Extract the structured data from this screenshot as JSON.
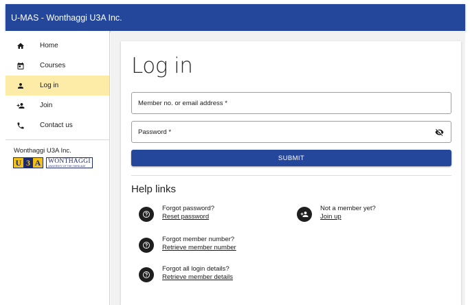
{
  "appbar": {
    "title": "U-MAS - Wonthaggi U3A Inc."
  },
  "sidebar": {
    "items": [
      {
        "label": "Home",
        "icon": "home-icon"
      },
      {
        "label": "Courses",
        "icon": "calendar-icon"
      },
      {
        "label": "Log in",
        "icon": "person-icon",
        "active": true
      },
      {
        "label": "Join",
        "icon": "person-add-icon"
      },
      {
        "label": "Contact us",
        "icon": "phone-icon"
      }
    ],
    "org_name": "Wonthaggi U3A Inc.",
    "logo": {
      "letters": [
        "U",
        "3",
        "A"
      ],
      "name": "WONTHAGGI",
      "tagline": "UNIVERSITY OF THE THIRD AGE"
    }
  },
  "login": {
    "title": "Log in",
    "member_label": "Member no. or email address *",
    "password_label": "Password *",
    "submit_label": "SUBMIT"
  },
  "help": {
    "title": "Help links",
    "items": [
      {
        "question": "Forgot password?",
        "link": "Reset password",
        "icon": "help-icon"
      },
      {
        "question": "Not a member yet?",
        "link": "Join up",
        "icon": "person-add-icon"
      },
      {
        "question": "Forgot member number?",
        "link": "Retrieve member number",
        "icon": "help-icon"
      },
      {
        "question": "Forgot all login details?",
        "link": "Retrieve member details",
        "icon": "help-icon"
      }
    ]
  },
  "colors": {
    "primary": "#24479c",
    "active_nav": "#fdeba8",
    "logo_gold": "#f3c21a",
    "logo_navy": "#1e2a6e"
  }
}
